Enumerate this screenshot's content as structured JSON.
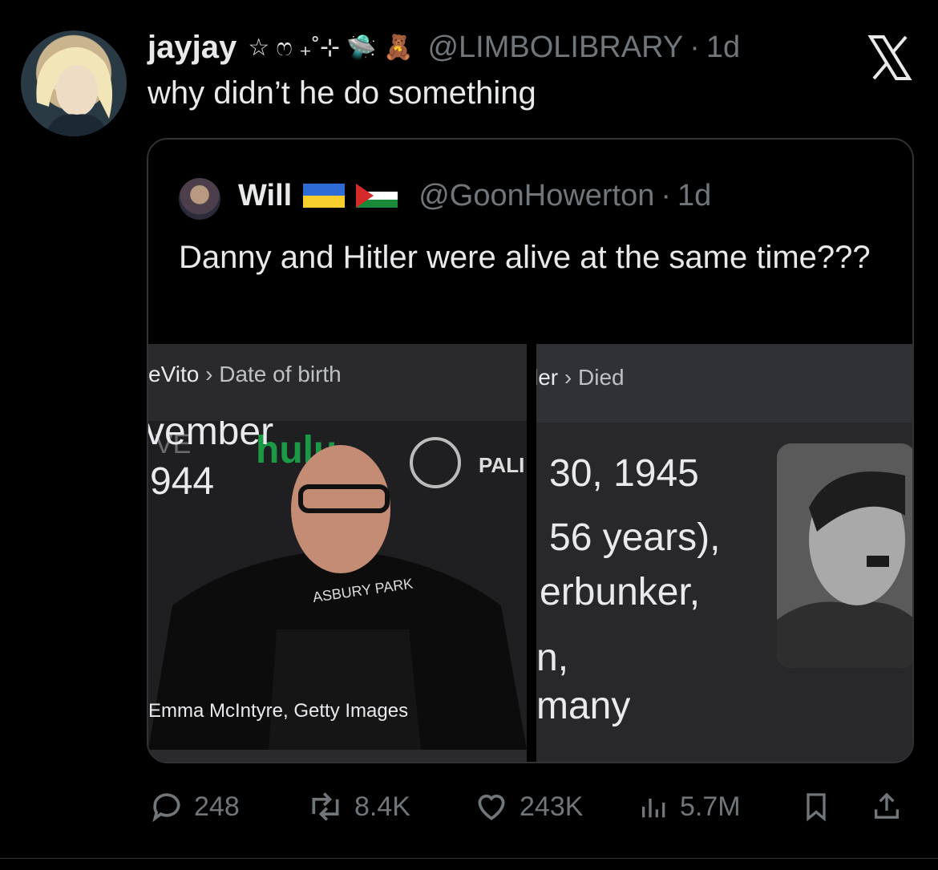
{
  "tweet": {
    "display_name": "jayjay",
    "name_emojis": "☆ ෆ ₊˚⊹ 🛸 🧸",
    "handle": "@LIMBOLIBRARY",
    "separator": "·",
    "time": "1d",
    "text": "why didn’t he do something"
  },
  "quote": {
    "display_name": "Will",
    "handle": "@GoonHowerton",
    "separator": "·",
    "time": "1d",
    "text": "Danny and Hitler were alive at the same time???",
    "media": {
      "left": {
        "crumb_prefix": "eVito",
        "crumb_arrow": "›",
        "crumb_label": "Date of birth",
        "text_lines": [
          "vember",
          "944"
        ],
        "photo_text": [
          "VE",
          "hulu",
          "PALI",
          "ASBURY PARK"
        ],
        "credit": "Emma McIntyre, Getty Images"
      },
      "right": {
        "crumb_prefix": "ler",
        "crumb_arrow": "›",
        "crumb_label": "Died",
        "text_lines": [
          "30, 1945",
          "56 years),",
          "erbunker,",
          "n,",
          "many"
        ]
      }
    }
  },
  "actions": {
    "replies": "248",
    "reposts": "8.4K",
    "likes": "243K",
    "views": "5.7M"
  },
  "icons": {
    "close": "x-logo-icon",
    "reply": "reply-icon",
    "repost": "repost-icon",
    "like": "heart-icon",
    "views": "views-icon",
    "bookmark": "bookmark-icon",
    "share": "share-icon"
  }
}
